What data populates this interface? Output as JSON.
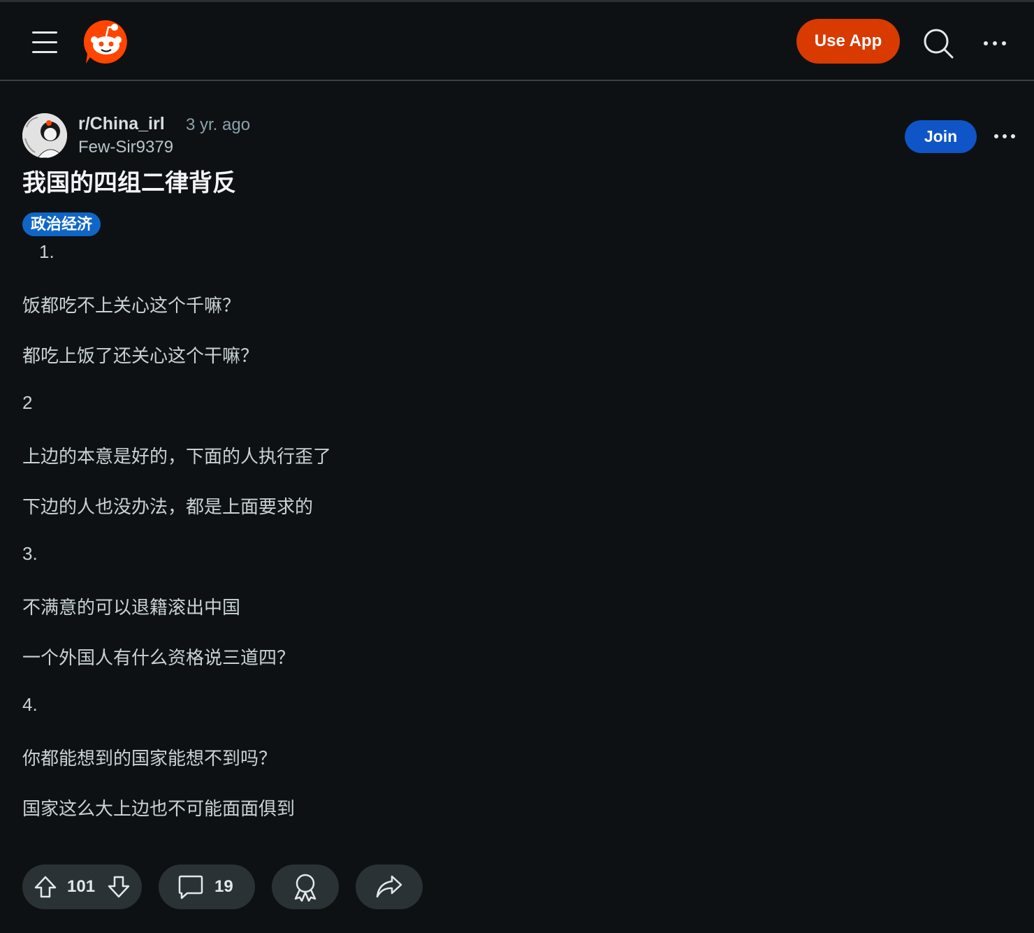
{
  "header": {
    "use_app_label": "Use App"
  },
  "post": {
    "subreddit": "r/China_irl",
    "time_ago": "3 yr. ago",
    "author": "Few-Sir9379",
    "join_label": "Join",
    "title": "我国的四组二律背反",
    "flair": "政治经济",
    "body_lines": [
      "1.",
      "饭都吃不上关心这个千嘛？",
      "都吃上饭了还关心这个干嘛？",
      "2",
      "上边的本意是好的，下面的人执行歪了",
      "下边的人也没办法，都是上面要求的",
      "3.",
      "不满意的可以退籍滚出中国",
      "一个外国人有什么资格说三道四？",
      "4.",
      "你都能想到的国家能想不到吗？",
      "国家这么大上边也不可能面面俱到"
    ]
  },
  "actions": {
    "upvotes": "101",
    "comments": "19"
  },
  "colors": {
    "background": "#0e1113",
    "use_app": "#d93a00",
    "join": "#0f55c7",
    "flair": "#0f66c7",
    "pill": "#2a3236"
  },
  "icons": [
    "menu-icon",
    "reddit-logo-icon",
    "search-icon",
    "more-icon",
    "upvote-icon",
    "downvote-icon",
    "comment-icon",
    "award-icon",
    "share-icon"
  ]
}
